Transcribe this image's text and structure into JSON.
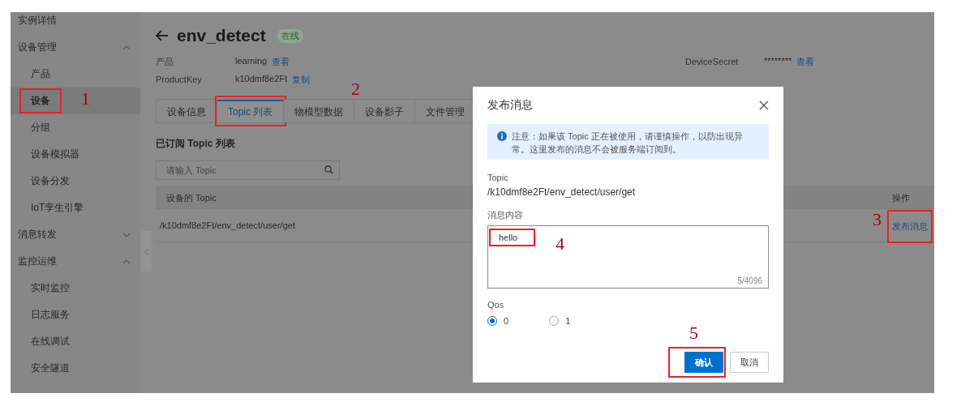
{
  "sidebar": {
    "items": [
      {
        "kind": "link",
        "label": "实例详情",
        "selected": false
      },
      {
        "kind": "group",
        "label": "设备管理",
        "expanded": true,
        "children": [
          {
            "label": "产品",
            "selected": false
          },
          {
            "label": "设备",
            "selected": true,
            "annotation": "1"
          },
          {
            "label": "分组",
            "selected": false
          },
          {
            "label": "设备模拟器",
            "selected": false
          },
          {
            "label": "设备分发",
            "selected": false
          },
          {
            "label": "IoT孪生引擎",
            "selected": false
          }
        ]
      },
      {
        "kind": "group",
        "label": "消息转发",
        "expanded": false
      },
      {
        "kind": "group",
        "label": "监控运维",
        "expanded": true,
        "children": [
          {
            "label": "实时监控",
            "selected": false
          },
          {
            "label": "日志服务",
            "selected": false
          },
          {
            "label": "在线调试",
            "selected": false
          },
          {
            "label": "安全隧道",
            "selected": false
          }
        ]
      }
    ]
  },
  "header": {
    "title": "env_detect",
    "status": "在线"
  },
  "info": [
    {
      "label": "产品",
      "value": "learning",
      "link": "查看",
      "side_label": "DeviceSecret",
      "side_value": "********",
      "side_link": "查看"
    },
    {
      "label": "ProductKey",
      "value": "k10dmf8e2Ft",
      "link": "复制"
    }
  ],
  "tabs": [
    {
      "label": "设备信息",
      "selected": false
    },
    {
      "label": "Topic 列表",
      "selected": true,
      "annotation": "2"
    },
    {
      "label": "物模型数据",
      "selected": false
    },
    {
      "label": "设备影子",
      "selected": false
    },
    {
      "label": "文件管理",
      "selected": false
    }
  ],
  "section_title": "已订阅 Topic 列表",
  "search": {
    "placeholder": "请输入 Topic"
  },
  "table": {
    "columns": [
      "设备的 Topic",
      "操作"
    ],
    "rows": [
      {
        "topic": "/k10dmf8e2Ft/env_detect/user/get",
        "action": "发布消息",
        "annotation": "3"
      }
    ]
  },
  "dialog": {
    "title": "发布消息",
    "notice": "注意：如果该 Topic 正在被使用，请谨慎操作，以防出现异常。这里发布的消息不会被服务端订阅到。",
    "topic_label": "Topic",
    "topic": "/k10dmf8e2Ft/env_detect/user/get",
    "content_label": "消息内容",
    "content": "hello",
    "content_annotation": "4",
    "counter": "5/4096",
    "qos_label": "Qos",
    "qos_options": [
      {
        "label": "0",
        "selected": true
      },
      {
        "label": "1",
        "selected": false
      }
    ],
    "buttons": [
      {
        "label": "确认",
        "kind": "primary",
        "annotation": "5"
      },
      {
        "label": "取消",
        "kind": "default"
      }
    ]
  }
}
